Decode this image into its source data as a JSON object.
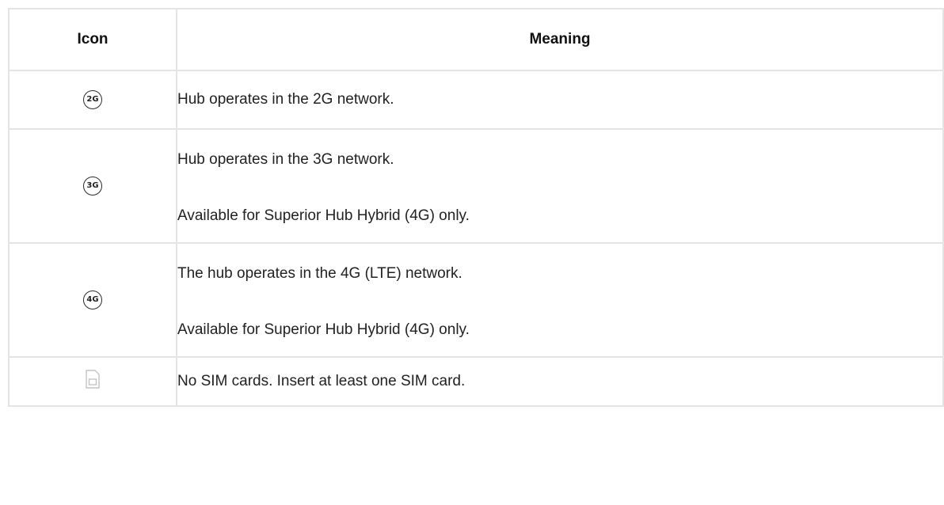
{
  "table": {
    "headers": {
      "icon": "Icon",
      "meaning": "Meaning"
    },
    "rows": [
      {
        "icon_name": "network-2g-icon",
        "icon_text": "2G",
        "lines": [
          "Hub operates in the 2G network."
        ]
      },
      {
        "icon_name": "network-3g-icon",
        "icon_text": "3G",
        "lines": [
          "Hub operates in the 3G network.",
          "Available for Superior Hub Hybrid (4G) only."
        ]
      },
      {
        "icon_name": "network-4g-icon",
        "icon_text": "4G",
        "lines": [
          "The hub operates in the 4G (LTE) network.",
          "Available for Superior Hub Hybrid (4G) only."
        ]
      },
      {
        "icon_name": "no-sim-card-icon",
        "lines": [
          "No SIM cards. Insert at least one SIM card."
        ]
      }
    ]
  },
  "colors": {
    "border": "#e4e4e4",
    "text": "#222222",
    "sim_icon": "#c4c4c4"
  }
}
